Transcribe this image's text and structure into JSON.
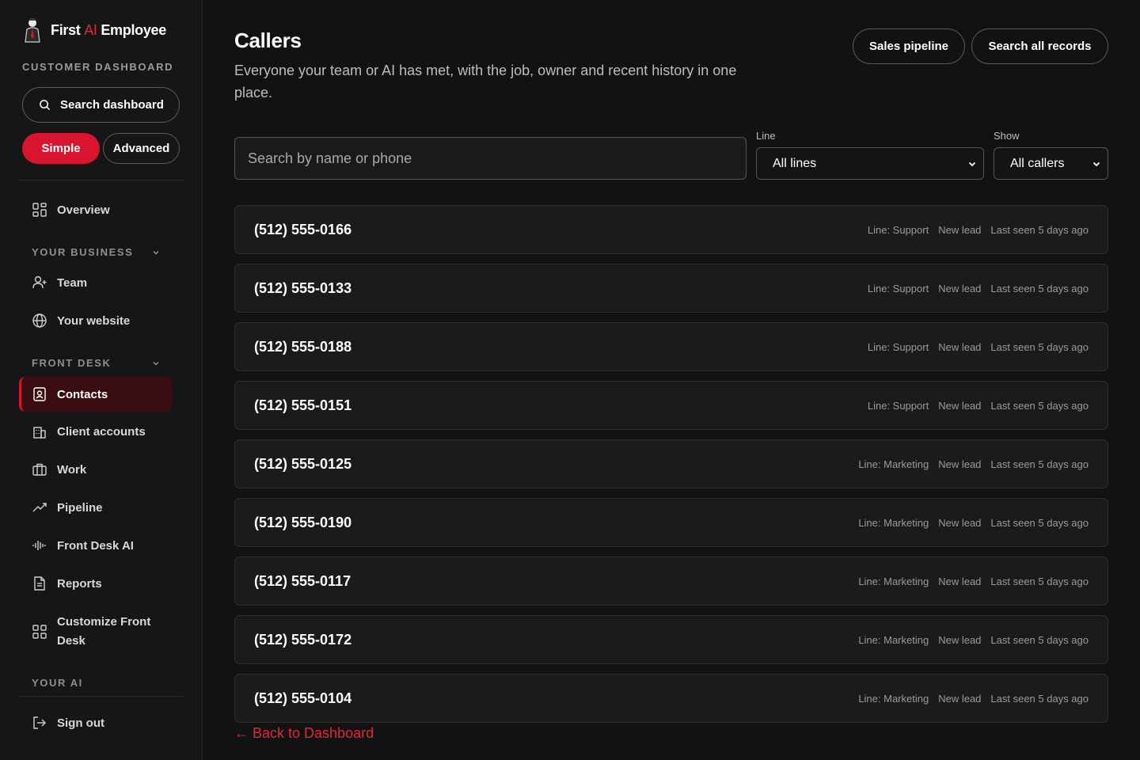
{
  "brand": {
    "first": "First ",
    "ai": "AI",
    "employee": " Employee"
  },
  "sidebar": {
    "dashboard_label": "CUSTOMER DASHBOARD",
    "search_label": "Search dashboard",
    "mode_simple": "Simple",
    "mode_advanced": "Advanced",
    "overview": "Overview",
    "section_business": "YOUR BUSINESS",
    "team": "Team",
    "website": "Your website",
    "section_front_desk": "FRONT DESK",
    "contacts": "Contacts",
    "client_accounts": "Client accounts",
    "work": "Work",
    "pipeline": "Pipeline",
    "front_desk_ai": "Front Desk AI",
    "reports": "Reports",
    "customize_1": "Customize Front",
    "customize_2": "Desk",
    "section_your_ai": "YOUR AI",
    "sign_out": "Sign out"
  },
  "header": {
    "title": "Callers",
    "subtitle": "Everyone your team or AI has met, with the job, owner and recent history in one place.",
    "sales_pipeline": "Sales pipeline",
    "search_all": "Search all records"
  },
  "filters": {
    "search_placeholder": "Search by name or phone",
    "line_label": "Line",
    "line_value": "All lines",
    "show_label": "Show",
    "show_value": "All callers"
  },
  "callers": [
    {
      "phone": "(512) 555-0166",
      "line": "Line: Support",
      "status": "New lead",
      "seen": "Last seen 5 days ago"
    },
    {
      "phone": "(512) 555-0133",
      "line": "Line: Support",
      "status": "New lead",
      "seen": "Last seen 5 days ago"
    },
    {
      "phone": "(512) 555-0188",
      "line": "Line: Support",
      "status": "New lead",
      "seen": "Last seen 5 days ago"
    },
    {
      "phone": "(512) 555-0151",
      "line": "Line: Support",
      "status": "New lead",
      "seen": "Last seen 5 days ago"
    },
    {
      "phone": "(512) 555-0125",
      "line": "Line: Marketing",
      "status": "New lead",
      "seen": "Last seen 5 days ago"
    },
    {
      "phone": "(512) 555-0190",
      "line": "Line: Marketing",
      "status": "New lead",
      "seen": "Last seen 5 days ago"
    },
    {
      "phone": "(512) 555-0117",
      "line": "Line: Marketing",
      "status": "New lead",
      "seen": "Last seen 5 days ago"
    },
    {
      "phone": "(512) 555-0172",
      "line": "Line: Marketing",
      "status": "New lead",
      "seen": "Last seen 5 days ago"
    },
    {
      "phone": "(512) 555-0104",
      "line": "Line: Marketing",
      "status": "New lead",
      "seen": "Last seen 5 days ago"
    }
  ],
  "back_link": "← Back to Dashboard",
  "colors": {
    "accent": "#d8142f",
    "background": "#121212",
    "sidebar": "#161616"
  }
}
